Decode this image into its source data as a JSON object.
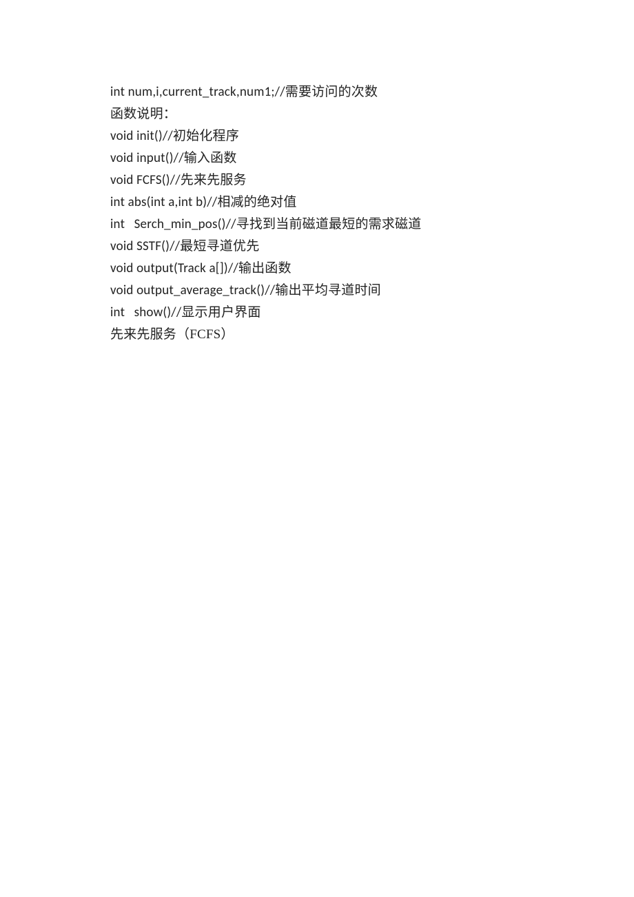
{
  "lines": [
    {
      "code": "int num,i,current_track,num1;//",
      "comment": "需要访问的次数"
    },
    {
      "code": "",
      "comment": "函数说明："
    },
    {
      "code": "void init()//",
      "comment": "初始化程序"
    },
    {
      "code": "void input()//",
      "comment": "输入函数"
    },
    {
      "code": "void FCFS()//",
      "comment": "先来先服务"
    },
    {
      "code": "int abs(int a,int b)//",
      "comment": "相减的绝对值"
    },
    {
      "code": "int   Serch_min_pos()//",
      "comment": "寻找到当前磁道最短的需求磁道"
    },
    {
      "code": "void SSTF()//",
      "comment": "最短寻道优先"
    },
    {
      "code": "void output(Track a[])//",
      "comment": "输出函数"
    },
    {
      "code": "void output_average_track()//",
      "comment": "输出平均寻道时间"
    },
    {
      "code": "int   show()//",
      "comment": "显示用户界面"
    },
    {
      "code": "",
      "comment": "先来先服务（FCFS）"
    }
  ]
}
